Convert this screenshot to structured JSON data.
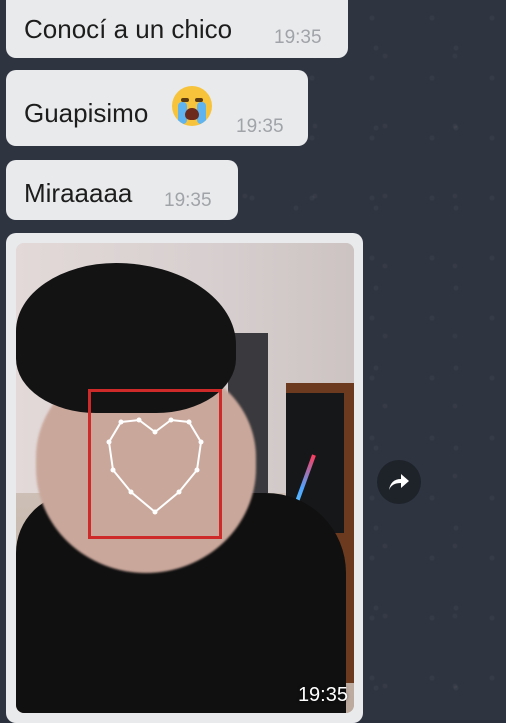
{
  "messages": [
    {
      "text": "Conocí a un chico",
      "time": "19:35"
    },
    {
      "text": "Guapisimo",
      "emoji": "loudly-crying-face-emoji",
      "time": "19:35"
    },
    {
      "text": "Miraaaaa",
      "time": "19:35"
    }
  ],
  "photo_message": {
    "time": "19:35"
  },
  "icons": {
    "share": "share-forward-icon"
  },
  "colors": {
    "bubble": "#e9eaec",
    "background": "#2e3440",
    "face_frame": "#cf2a2a"
  }
}
